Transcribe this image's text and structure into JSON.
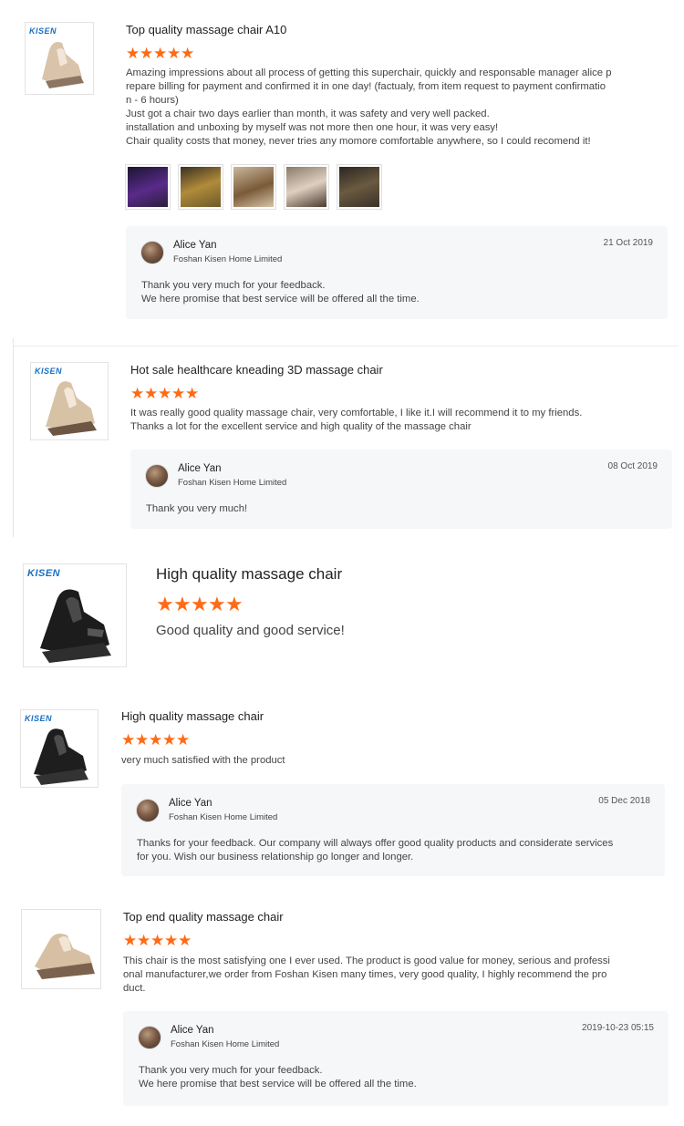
{
  "reviews": [
    {
      "logo": "KISEN",
      "title": "Top quality massage chair A10",
      "stars": 5,
      "text": [
        "Amazing impressions about all process of getting this superchair, quickly and responsable manager alice p",
        "repare billing for payment and confirmed it in one day! (factualy, from item request to payment confirmatio",
        "n - 6 hours)",
        "Just got a  chair   two days earlier than month, it was  safety and very well  packed.",
        "installation  and  unboxing by myself was not more then one hour,  it was very easy!",
        "Chair quality costs that money, never tries any momore comfortable anywhere, so I could recomend it!"
      ],
      "reply": {
        "name": "Alice Yan",
        "company": "Foshan Kisen Home Limited",
        "date": "21 Oct 2019",
        "text": [
          "Thank you very much for your feedback.",
          "We here promise that best service will be offered all the time."
        ]
      }
    },
    {
      "logo": "KISEN",
      "title": "Hot sale healthcare kneading 3D massage chair",
      "stars": 5,
      "text": [
        "It was really good quality massage chair, very comfortable, I like it.I will recommend it to my friends.",
        "Thanks a lot for the excellent  service and high quality of the massage chair"
      ],
      "reply": {
        "name": "Alice Yan",
        "company": "Foshan Kisen Home Limited",
        "date": "08 Oct 2019",
        "text": [
          "Thank you very much!"
        ]
      }
    },
    {
      "logo": "KISEN",
      "title": "High quality massage chair",
      "stars": 5,
      "text": [
        "Good quality and good service!"
      ]
    },
    {
      "logo": "KISEN",
      "title": "High quality massage chair",
      "stars": 5,
      "text": [
        "very much satisfied with the product"
      ],
      "reply": {
        "name": "Alice Yan",
        "company": "Foshan Kisen Home Limited",
        "date": "05 Dec 2018",
        "text": [
          "Thanks for your feedback. Our company will always offer good quality products and considerate services",
          "for you. Wish our business relationship go longer and longer."
        ]
      }
    },
    {
      "logo": "",
      "title": "Top end quality massage chair",
      "stars": 5,
      "text": [
        "This chair is the most satisfying one I ever used. The product is good value for money, serious and professi",
        "onal manufacturer,we order from Foshan Kisen many times, very good quality, I highly recommend the pro",
        "duct."
      ],
      "reply": {
        "name": "Alice Yan",
        "company": "Foshan Kisen Home Limited",
        "date": "2019-10-23 05:15",
        "text": [
          "Thank you very much for your feedback.",
          "We here promise that best service will be offered all the time."
        ]
      }
    }
  ],
  "colors": {
    "star": "#ff6a14",
    "logo": "#1a6fc2",
    "reply_bg": "#f6f7f9"
  },
  "icons": {
    "star": "star-icon",
    "avatar": "avatar"
  }
}
